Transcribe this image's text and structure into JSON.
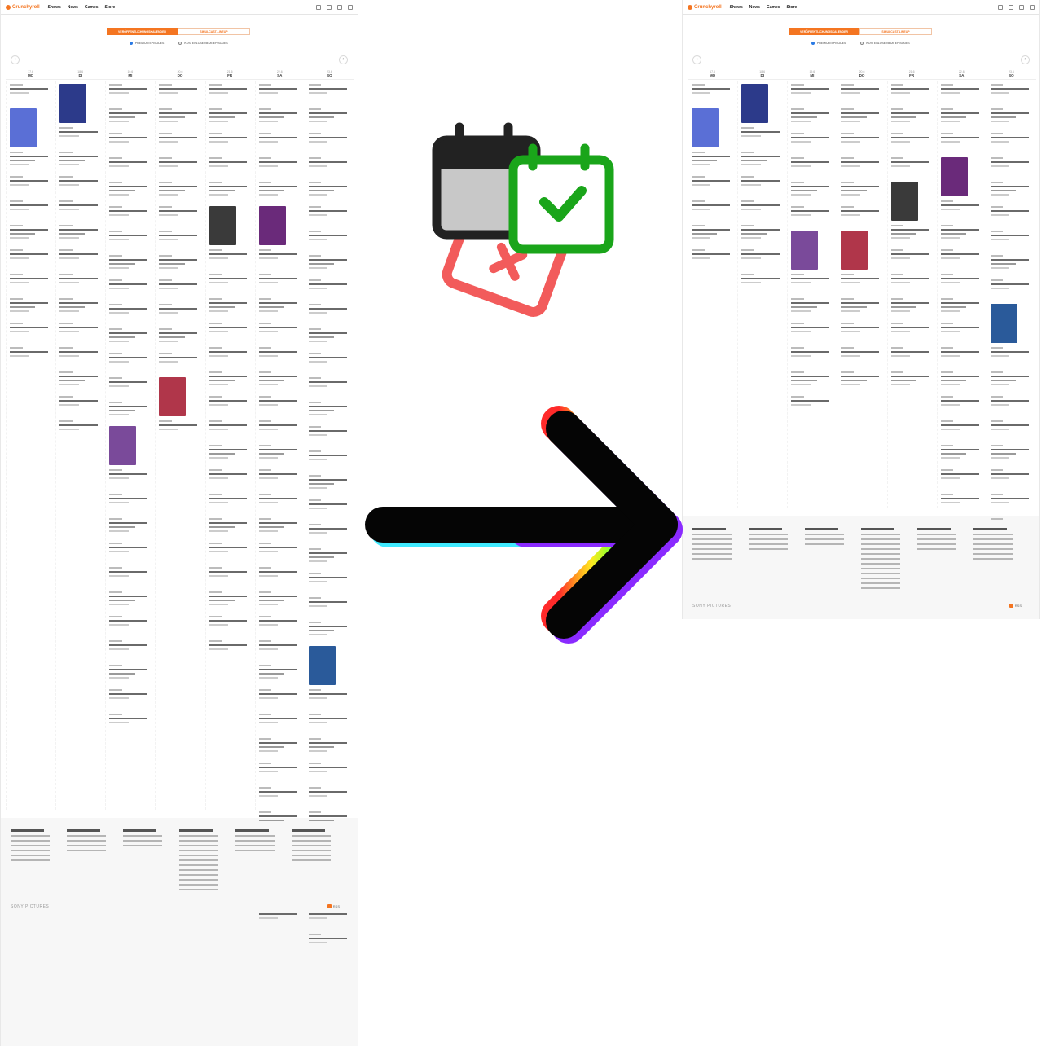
{
  "screenshot": {
    "brand_name": "Crunchyroll",
    "nav": [
      "Shows",
      "News",
      "Games",
      "Store"
    ],
    "tabs": {
      "active": "VERÖFFENTLICHUNGSKALENDER",
      "inactive": "SIMULCAST-LINEUP"
    },
    "filters": [
      "PREMIUM EPISODES",
      "KOSTENLOSE NEUE EPISODES"
    ],
    "days": [
      {
        "date": "17.6",
        "name": "MO"
      },
      {
        "date": "18.6",
        "name": "DI"
      },
      {
        "date": "19.6",
        "name": "MI"
      },
      {
        "date": "20.6",
        "name": "DO"
      },
      {
        "date": "21.6",
        "name": "FR"
      },
      {
        "date": "22.6",
        "name": "SA"
      },
      {
        "date": "23.6",
        "name": "SO"
      }
    ],
    "footer_brand": "SONY PICTURES",
    "rss_label": "RSS"
  },
  "colors": {
    "brand_orange": "#f47521",
    "calendar_outline": "#222222",
    "calendar_body": "#c8c8c8",
    "calendar_check_green": "#1aa51a",
    "calendar_cross_red": "#f25b5b"
  },
  "icons": [
    "calendar-back-icon",
    "calendar-check-icon",
    "calendar-cross-icon",
    "rainbow-arrow-icon"
  ]
}
